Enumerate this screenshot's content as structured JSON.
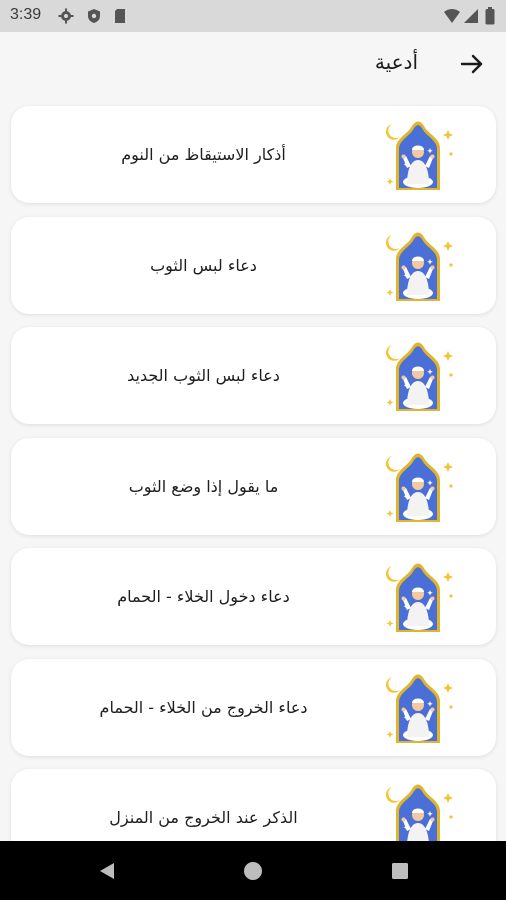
{
  "status_bar": {
    "time": "3:39",
    "icons_left": [
      "gear-icon",
      "shield-icon",
      "sd-card-icon"
    ],
    "icons_right": [
      "wifi-icon",
      "signal-icon",
      "battery-icon"
    ]
  },
  "header": {
    "title": "أدعية",
    "back_icon": "arrow-right-icon"
  },
  "list": {
    "items": [
      {
        "label": "أذكار الاستيقاظ من النوم",
        "icon": "praying-person-icon"
      },
      {
        "label": "دعاء لبس الثوب",
        "icon": "praying-person-icon"
      },
      {
        "label": "دعاء لبس الثوب الجديد",
        "icon": "praying-person-icon"
      },
      {
        "label": "ما يقول إذا وضع الثوب",
        "icon": "praying-person-icon"
      },
      {
        "label": "دعاء دخول الخلاء - الحمام",
        "icon": "praying-person-icon"
      },
      {
        "label": "دعاء الخروج من الخلاء - الحمام",
        "icon": "praying-person-icon"
      },
      {
        "label": "الذكر عند الخروج من المنزل",
        "icon": "praying-person-icon"
      }
    ]
  },
  "nav_bar": {
    "buttons": [
      "back-triangle-icon",
      "home-circle-icon",
      "recents-square-icon"
    ]
  },
  "colors": {
    "accent_blue": "#4a6fd6",
    "frame_gold": "#e0b52c",
    "background": "#f6f6f6",
    "card": "#ffffff"
  }
}
